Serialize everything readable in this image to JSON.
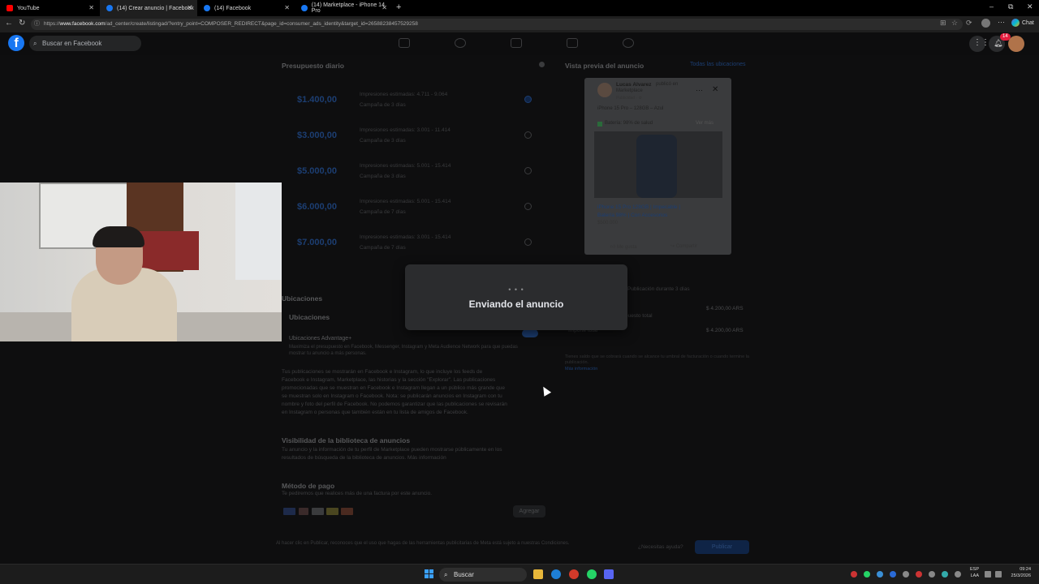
{
  "browser": {
    "tabs": [
      {
        "title": "YouTube",
        "color": "#ff0000"
      },
      {
        "title": "(14) Crear anuncio | Facebook",
        "color": "#1877f2"
      },
      {
        "title": "(14) Facebook",
        "color": "#1877f2"
      },
      {
        "title": "(14) Marketplace - iPhone 14 Pro",
        "color": "#1877f2"
      }
    ],
    "url_prefix": "https://",
    "url_domain": "www.facebook.com",
    "url_path": "/ad_center/create/listingad/?entry_point=COMPOSER_REDIRECT&page_id=consumer_ads_identity&target_id=26588238457529258",
    "chat_label": "Chat"
  },
  "facebook": {
    "search_placeholder": "Buscar en Facebook",
    "notification_count": "14"
  },
  "form": {
    "daily_budget_title": "Presupuesto diario",
    "budgets": [
      {
        "amount": "$1.400,00",
        "reach": "Impresiones estimadas: 4.711 - 9.064",
        "duration": "Campaña de 3 días",
        "selected": true
      },
      {
        "amount": "$3.000,00",
        "reach": "Impresiones estimadas: 3.001 - 11.414",
        "duration": "Campaña de 3 días",
        "selected": false
      },
      {
        "amount": "$5.000,00",
        "reach": "Impresiones estimadas: 5.001 - 15.414",
        "duration": "Campaña de 3 días",
        "selected": false
      },
      {
        "amount": "$6.000,00",
        "reach": "Impresiones estimadas: 5.001 - 15.414",
        "duration": "Campaña de 7 días",
        "selected": false
      },
      {
        "amount": "$7.000,00",
        "reach": "Impresiones estimadas: 3.001 - 15.414",
        "duration": "Campaña de 7 días",
        "selected": false
      }
    ],
    "placements_title": "Ubicaciones",
    "placements_sub": "Ubicaciones",
    "advantage_label": "Ubicaciones Advantage+",
    "advantage_desc": "Maximiza el presupuesto en Facebook, Messenger, Instagram y Meta Audience Network para que puedas mostrar tu anuncio a más personas.",
    "placements_note_lines": [
      "Tus publicaciones se mostrarán en Facebook e Instagram, lo que incluye los feeds de",
      "Facebook e Instagram, Marketplace, las historias y la sección \"Explorar\". Las publicaciones",
      "promocionadas que se muestran en Facebook e Instagram llegan a un público más grande que",
      "se muestran solo en Instagram o Facebook. Nota: se publicarán anuncios en Instagram con tu",
      "nombre y foto del perfil de Facebook. No podemos garantizar que las publicaciones se revisarán",
      "en Instagram o personas que también están en tu lista de amigos de Facebook."
    ],
    "library_title": "Visibilidad de la biblioteca de anuncios",
    "library_lines": [
      "Tu anuncio y la información de tu perfil de Marketplace pueden mostrarse públicamente en los",
      "resultados de búsqueda de la biblioteca de anuncios. Más información"
    ],
    "payment_title": "Método de pago",
    "payment_desc": "Te pediremos que realices más de una factura por este anuncio.",
    "add_label": "Agregar",
    "footer_text": "Al hacer clic en Publicar, reconoces que el uso que hagas de las herramientas publicitarias de Meta está sujeto a nuestras Condiciones.",
    "help_label": "¿Necesitas ayuda?",
    "publish_label": "Publicar"
  },
  "preview": {
    "title": "Vista previa del anuncio",
    "link": "Todas las ubicaciones",
    "author": "Lucas Alvarez",
    "action": "publicó en",
    "action2": "Marketplace",
    "sponsored": "Publicidad · ⚙",
    "item_line": "iPhone 15 Pro – 128GB – Azul",
    "battery": "Batería: 98% de salud",
    "see_more": "Ver más",
    "listing_title_1": "iPhone 15 Pro 128GB | Impecable |",
    "listing_title_2": "Batería 98% | Con Accesorios",
    "price": "$500.000",
    "like": "Me gusta",
    "share": "Compartir"
  },
  "summary": {
    "duration": "Publicación durante 3 días",
    "rows": [
      {
        "label": "Presupuesto total",
        "value": "$ 4.200,00 ARS"
      },
      {
        "label": "Importe total",
        "value": "$ 4.200,00 ARS"
      }
    ],
    "note": "Tienes saldo que se cobrará cuando se alcance tu umbral de facturación o cuando termine la publicación.",
    "note_link": "Más información"
  },
  "modal": {
    "dots": "• • •",
    "message": "Enviando el anuncio"
  },
  "taskbar": {
    "search_label": "Buscar",
    "lang_1": "ESP",
    "lang_2": "LAA",
    "time": "09:24",
    "date": "25/3/2026"
  }
}
